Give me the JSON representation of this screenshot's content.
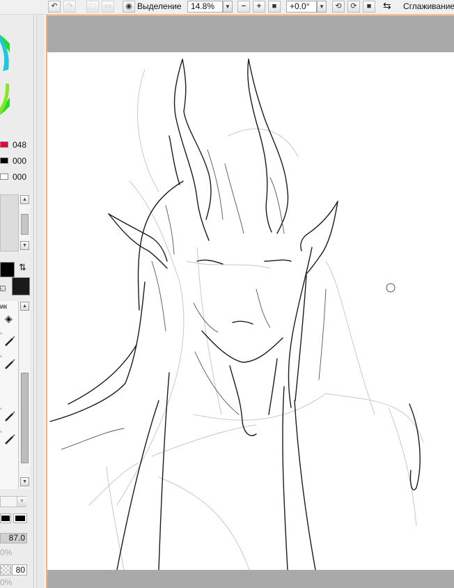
{
  "toolbar": {
    "view_label": "Выделение",
    "zoom": "14.8%",
    "rotation": "+0.0°",
    "smoothing_label": "Сглаживание"
  },
  "left_panel": {
    "color_values": [
      "048",
      "000",
      "000"
    ],
    "swatch_colors": [
      "#e8003a",
      "#000000",
      "#ffffff"
    ],
    "tool_label": "ик",
    "opacity_value": "87.0",
    "percent_label": "0%",
    "size_value": "80",
    "foreground_color": "#000000",
    "background_color": "#1a1a1a"
  },
  "canvas": {
    "border_color": "#f2b27a",
    "bg_color": "#a9a9a9"
  },
  "icons": [
    "undo-icon",
    "redo-icon",
    "deselect-icon",
    "clear-icon",
    "eye-icon",
    "zoom-out-icon",
    "zoom-in-icon",
    "reset-zoom-icon",
    "rotate-left-icon",
    "rotate-right-icon",
    "reset-rotation-icon",
    "flip-icon",
    "swap-colors-icon",
    "eraser-icon",
    "brush-icon",
    "pen-icon"
  ]
}
